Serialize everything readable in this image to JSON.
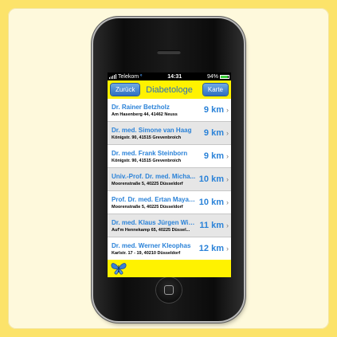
{
  "status_bar": {
    "carrier": "Telekom",
    "time": "14:31",
    "battery": "94%"
  },
  "nav": {
    "back_label": "Zurück",
    "title": "Diabetologe",
    "map_label": "Karte"
  },
  "doctors": [
    {
      "name": "Dr. Rainer Betzholz",
      "address": "Am Hasenberg 44, 41462 Neuss",
      "distance": "9 km"
    },
    {
      "name": "Dr. med. Simone van Haag",
      "address": "Königstr. 90, 41515 Grevenbroich",
      "distance": "9 km"
    },
    {
      "name": "Dr. med. Frank Steinborn",
      "address": "Königstr. 90, 41515 Grevenbroich",
      "distance": "9 km"
    },
    {
      "name": "Univ.-Prof. Dr. med. Micha...",
      "address": "Moorenstraße 5, 40225 Düsseldorf",
      "distance": "10 km"
    },
    {
      "name": "Prof. Dr. med. Ertan Mayat...",
      "address": "Moorenstraße 5, 40225 Düsseldorf",
      "distance": "10 km"
    },
    {
      "name": "Dr. med. Klaus Jürgen Wie...",
      "address": "Auf'm Hennekamp 65, 40225 Düssel...",
      "distance": "11 km"
    },
    {
      "name": "Dr. med. Werner Kleophas",
      "address": "Karlstr. 17 - 19, 40210 Düsseldorf",
      "distance": "12 km"
    }
  ],
  "colors": {
    "background": "#fce36a",
    "panel": "#fef9dc",
    "app_yellow": "#fff200",
    "link_blue": "#2a82d8",
    "button_blue": "#2e6fc0"
  },
  "icons": {
    "footer_logo": "butterfly-icon",
    "chevron": "chevron-right-icon"
  }
}
